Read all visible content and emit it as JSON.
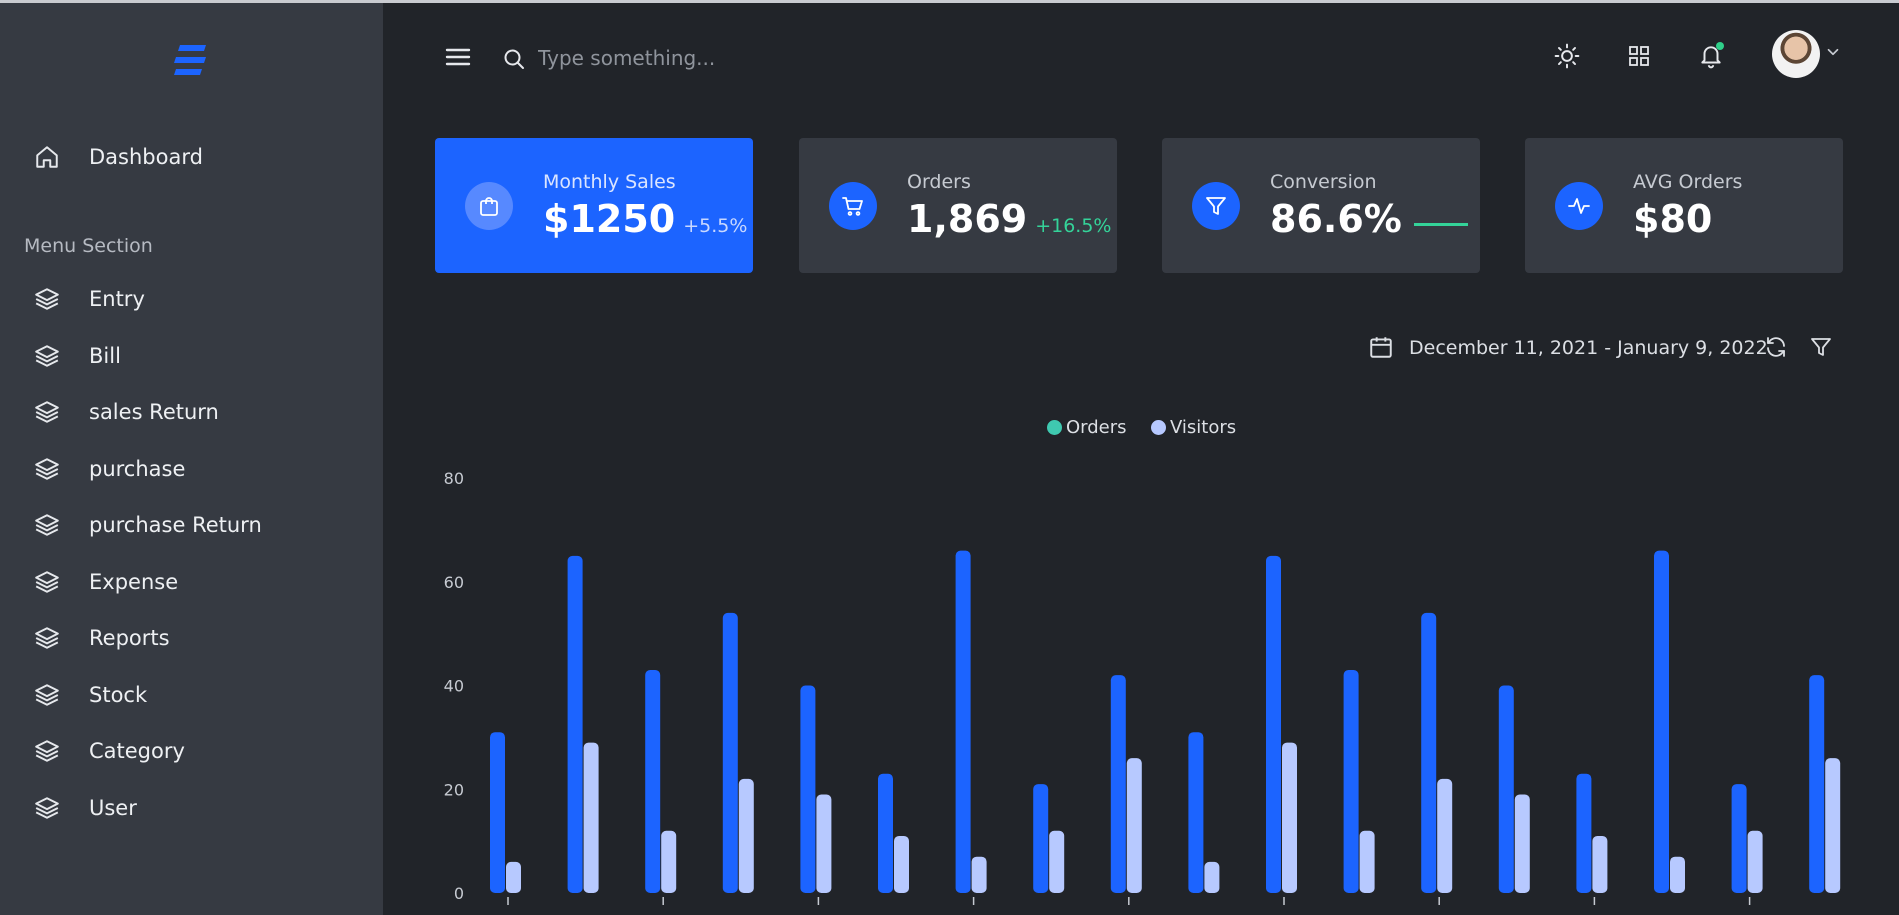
{
  "header": {
    "search_placeholder": "Type something..."
  },
  "sidebar": {
    "items": [
      {
        "label": "Dashboard"
      },
      {
        "label": "Entry"
      },
      {
        "label": "Bill"
      },
      {
        "label": "sales Return"
      },
      {
        "label": "purchase"
      },
      {
        "label": "purchase Return"
      },
      {
        "label": "Expense"
      },
      {
        "label": "Reports"
      },
      {
        "label": "Stock"
      },
      {
        "label": "Category"
      },
      {
        "label": "User"
      }
    ],
    "section_title": "Menu Section"
  },
  "cards": [
    {
      "title": "Monthly Sales",
      "value": "$1250",
      "delta": "+5.5%",
      "icon": "shopping-bag-icon"
    },
    {
      "title": "Orders",
      "value": "1,869",
      "delta": "+16.5%",
      "icon": "cart-icon"
    },
    {
      "title": "Conversion",
      "value": "86.6%",
      "delta": "",
      "icon": "filter-icon"
    },
    {
      "title": "AVG Orders",
      "value": "$80",
      "delta": "",
      "icon": "activity-icon"
    }
  ],
  "toolbar": {
    "date_range": "December 11, 2021 - January 9, 2022"
  },
  "colors": {
    "accent": "#1c64ff",
    "orders": "#1c64ff",
    "visitors": "#b7c9ff",
    "positive": "#34d399",
    "legend_orders_dot": "#3fc9b0"
  },
  "chart_data": {
    "type": "bar",
    "legend": [
      "Orders",
      "Visitors"
    ],
    "legend_position": "top-center",
    "ylim": [
      0,
      80
    ],
    "yticks": [
      0,
      20,
      40,
      60,
      80
    ],
    "grid": false,
    "series": [
      {
        "name": "Orders",
        "values": [
          31,
          65,
          43,
          54,
          40,
          23,
          66,
          21,
          42,
          31,
          65,
          43,
          54,
          40,
          23,
          66,
          21,
          42
        ]
      },
      {
        "name": "Visitors",
        "values": [
          6,
          29,
          12,
          22,
          19,
          11,
          7,
          12,
          26,
          6,
          29,
          12,
          22,
          19,
          11,
          7,
          12,
          26
        ]
      }
    ]
  }
}
